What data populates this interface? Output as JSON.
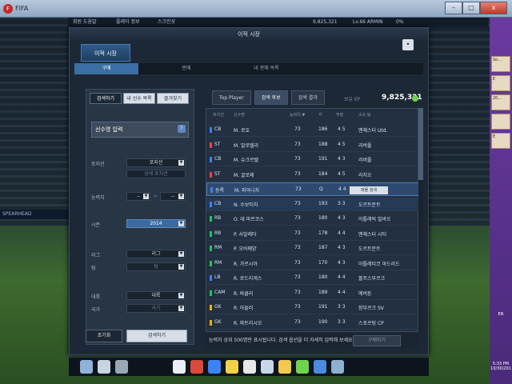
{
  "window": {
    "title": "FIFA",
    "minimize": "–",
    "maximize": "□",
    "close": "x"
  },
  "hud": {
    "chip1": "회원 도움말",
    "chip2": "플레이 정보",
    "chip3": "스크린샷",
    "ep": "9,825,321",
    "level": "Lv.66 ARMIN",
    "percent": "0%"
  },
  "ad_board": "SPEARHEAD",
  "panel": {
    "title": "이적 시장",
    "main_tab": "이적 시장",
    "subtabs": [
      "구매",
      "판매",
      "내 판매 목록"
    ],
    "close": "•"
  },
  "left": {
    "buttons": [
      "검색하기",
      "내 선수 목록",
      "즐겨찾기"
    ],
    "name_input": "선수명 입력",
    "help": "?",
    "filters": {
      "position_label": "포지션",
      "position_value": "포지션",
      "position_detail": "상세 포지션",
      "ability_label": "능력치",
      "ability_from": "--",
      "ability_sep": "~",
      "ability_to": "--",
      "season_label": "시즌",
      "season_value": "2014",
      "league_label": "리그",
      "league_value": "리그",
      "team_label": "팀",
      "team_value": "팀",
      "continent_label": "대륙",
      "continent_value": "대륙",
      "country_label": "국가",
      "country_value": "국가"
    },
    "reset": "초기화",
    "search": "검색하기"
  },
  "right": {
    "tabs": [
      "Top Player",
      "검색 후보",
      "검색 결과"
    ],
    "ep_label": "보유 EP",
    "ep_value": "9,825,321",
    "columns": [
      "포지션",
      "선수명",
      "능력치 ▼",
      "키",
      "주발",
      "소속 팀"
    ],
    "rows": [
      {
        "pos": "CB",
        "color": "#3b82f6",
        "name": "M. 로호",
        "ovr": "73",
        "height": "186",
        "foot": "4 5",
        "club": "맨체스터 Utd."
      },
      {
        "pos": "ST",
        "color": "#ef4444",
        "name": "M. 발로텔리",
        "ovr": "73",
        "height": "188",
        "foot": "4 5",
        "club": "리버풀"
      },
      {
        "pos": "CB",
        "color": "#3b82f6",
        "name": "M. 슈크르텔",
        "ovr": "73",
        "height": "191",
        "foot": "4 3",
        "club": "리버풀"
      },
      {
        "pos": "ST",
        "color": "#ef4444",
        "name": "M. 굴로제",
        "ovr": "73",
        "height": "184",
        "foot": "4 5",
        "club": "라치오"
      },
      {
        "pos": "등록",
        "color": "#3b82f6",
        "name": "M. 피아니치",
        "ovr": "73",
        "height": "Q",
        "foot": "4 4",
        "club": "",
        "compare": "매물 검색"
      },
      {
        "pos": "CB",
        "color": "#3b82f6",
        "name": "N. 수보티치",
        "ovr": "73",
        "height": "193",
        "foot": "3 3",
        "club": "도르트문트"
      },
      {
        "pos": "RB",
        "color": "#22c55e",
        "name": "O. 데 마르코스",
        "ovr": "73",
        "height": "180",
        "foot": "4 3",
        "club": "아틀레틱 빌바오"
      },
      {
        "pos": "RB",
        "color": "#22c55e",
        "name": "P. 사발레타",
        "ovr": "73",
        "height": "178",
        "foot": "4 4",
        "club": "맨체스터 시티"
      },
      {
        "pos": "RM",
        "color": "#22c55e",
        "name": "P. 오바메양",
        "ovr": "73",
        "height": "187",
        "foot": "4 3",
        "club": "도르트문트"
      },
      {
        "pos": "RM",
        "color": "#22c55e",
        "name": "R. 가르시아",
        "ovr": "73",
        "height": "170",
        "foot": "4 3",
        "club": "아틀레티코 마드리드"
      },
      {
        "pos": "LB",
        "color": "#3b82f6",
        "name": "R. 로드리게스",
        "ovr": "73",
        "height": "180",
        "foot": "4 4",
        "club": "볼프스부르크"
      },
      {
        "pos": "CAM",
        "color": "#22c55e",
        "name": "R. 바클리",
        "ovr": "73",
        "height": "189",
        "foot": "4 4",
        "club": "에버튼"
      },
      {
        "pos": "GK",
        "color": "#eab308",
        "name": "R. 아들러",
        "ovr": "73",
        "height": "191",
        "foot": "3 3",
        "club": "함부르크 SV"
      },
      {
        "pos": "GK",
        "color": "#eab308",
        "name": "R. 파트리시오",
        "ovr": "73",
        "height": "190",
        "foot": "3 3",
        "club": "스포르팅 CP"
      }
    ],
    "status_text": "능력치 상위 500명만 표시됩니다. 검색 옵션을 더 자세히 입력해 보세요.",
    "buy_button": "구매하기"
  },
  "dock_icons": [
    "news-icon",
    "card-icon",
    "mail-icon",
    "tag-icon",
    "ball-icon",
    "player-icon",
    "trophy-icon",
    "cards-icon",
    "notepad-icon",
    "coin-icon",
    "lab-icon",
    "skill-icon",
    "trash-icon"
  ],
  "side_items": [
    "So...",
    "E",
    "20...",
    "",
    "E"
  ],
  "tray": {
    "lang": "EN",
    "time": "5:33 PM",
    "date": "10/30/201"
  }
}
